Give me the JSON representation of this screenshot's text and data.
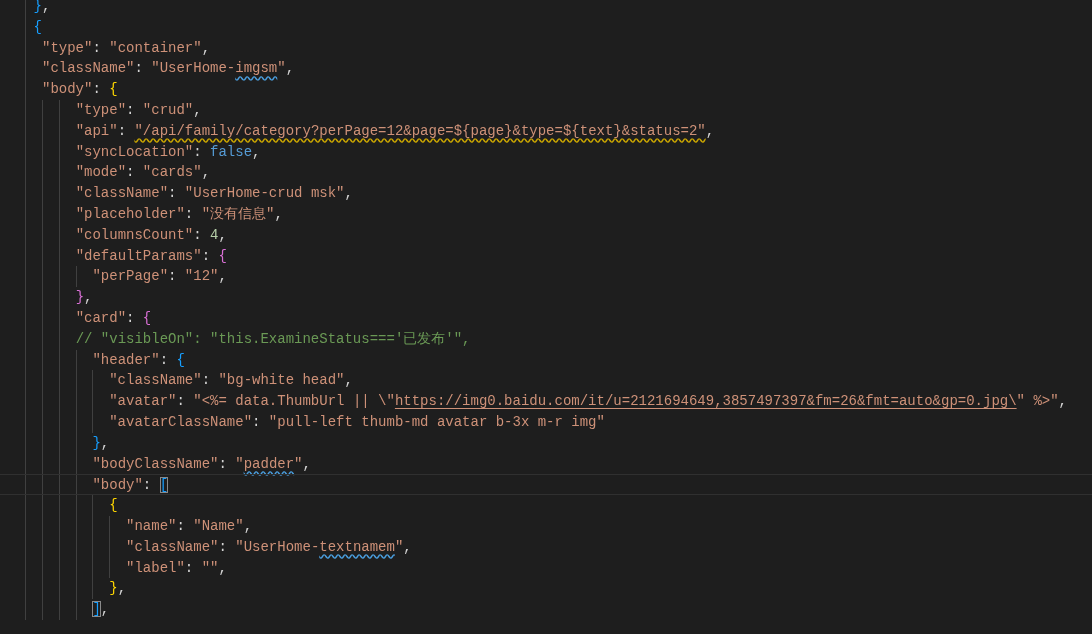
{
  "editor": {
    "lines": [
      {
        "tokens": [
          {
            "kind": "bracket",
            "text": "    }",
            "color": "#179fff"
          },
          {
            "kind": "punct",
            "text": ","
          }
        ]
      },
      {
        "tokens": [
          {
            "kind": "bracket",
            "text": "    {",
            "color": "#179fff"
          }
        ]
      },
      {
        "tokens": [
          {
            "kind": "key",
            "text": "     \"type\""
          },
          {
            "kind": "punct",
            "text": ": "
          },
          {
            "kind": "string",
            "text": "\"container\""
          },
          {
            "kind": "punct",
            "text": ","
          }
        ]
      },
      {
        "tokens": [
          {
            "kind": "key",
            "text": "     \"className\""
          },
          {
            "kind": "punct",
            "text": ": "
          },
          {
            "kind": "string",
            "text": "\"UserHome-"
          },
          {
            "kind": "string",
            "text": "imgsm",
            "spelling_error": true
          },
          {
            "kind": "string",
            "text": "\""
          },
          {
            "kind": "punct",
            "text": ","
          }
        ]
      },
      {
        "tokens": [
          {
            "kind": "key",
            "text": "     \"body\""
          },
          {
            "kind": "punct",
            "text": ": "
          },
          {
            "kind": "bracket",
            "text": "{",
            "color": "#ffd700"
          }
        ]
      },
      {
        "tokens": [
          {
            "kind": "key",
            "text": "         \"type\""
          },
          {
            "kind": "punct",
            "text": ": "
          },
          {
            "kind": "string",
            "text": "\"crud\""
          },
          {
            "kind": "punct",
            "text": ","
          }
        ]
      },
      {
        "tokens": [
          {
            "kind": "key",
            "text": "         \"api\""
          },
          {
            "kind": "punct",
            "text": ": "
          },
          {
            "kind": "string",
            "text": "\"/api/family/category?perPage=12&page=${page}&type=${text}&status=2\"",
            "warning": true
          },
          {
            "kind": "punct",
            "text": ","
          }
        ]
      },
      {
        "tokens": [
          {
            "kind": "key",
            "text": "         \"syncLocation\""
          },
          {
            "kind": "punct",
            "text": ": "
          },
          {
            "kind": "keyword",
            "text": "false"
          },
          {
            "kind": "punct",
            "text": ","
          }
        ]
      },
      {
        "tokens": [
          {
            "kind": "key",
            "text": "         \"mode\""
          },
          {
            "kind": "punct",
            "text": ": "
          },
          {
            "kind": "string",
            "text": "\"cards\""
          },
          {
            "kind": "punct",
            "text": ","
          }
        ]
      },
      {
        "tokens": [
          {
            "kind": "key",
            "text": "         \"className\""
          },
          {
            "kind": "punct",
            "text": ": "
          },
          {
            "kind": "string",
            "text": "\"UserHome-crud msk\""
          },
          {
            "kind": "punct",
            "text": ","
          }
        ]
      },
      {
        "tokens": [
          {
            "kind": "key",
            "text": "         \"placeholder\""
          },
          {
            "kind": "punct",
            "text": ": "
          },
          {
            "kind": "string",
            "text": "\"没有信息\""
          },
          {
            "kind": "punct",
            "text": ","
          }
        ]
      },
      {
        "tokens": [
          {
            "kind": "key",
            "text": "         \"columnsCount\""
          },
          {
            "kind": "punct",
            "text": ": "
          },
          {
            "kind": "number",
            "text": "4"
          },
          {
            "kind": "punct",
            "text": ","
          }
        ]
      },
      {
        "tokens": [
          {
            "kind": "key",
            "text": "         \"defaultParams\""
          },
          {
            "kind": "punct",
            "text": ": "
          },
          {
            "kind": "bracket",
            "text": "{",
            "color": "#da70d6"
          }
        ]
      },
      {
        "tokens": [
          {
            "kind": "key",
            "text": "           \"perPage\""
          },
          {
            "kind": "punct",
            "text": ": "
          },
          {
            "kind": "string",
            "text": "\"12\""
          },
          {
            "kind": "punct",
            "text": ","
          }
        ]
      },
      {
        "tokens": [
          {
            "kind": "bracket",
            "text": "         }",
            "color": "#da70d6"
          },
          {
            "kind": "punct",
            "text": ","
          }
        ]
      },
      {
        "tokens": [
          {
            "kind": "key",
            "text": "         \"card\""
          },
          {
            "kind": "punct",
            "text": ": "
          },
          {
            "kind": "bracket",
            "text": "{",
            "color": "#da70d6"
          }
        ]
      },
      {
        "tokens": [
          {
            "kind": "comment",
            "text": "         // \"visibleOn\": \"this.ExamineStatus==='已发布'\","
          }
        ]
      },
      {
        "tokens": [
          {
            "kind": "key",
            "text": "           \"header\""
          },
          {
            "kind": "punct",
            "text": ": "
          },
          {
            "kind": "bracket",
            "text": "{",
            "color": "#179fff"
          }
        ]
      },
      {
        "tokens": [
          {
            "kind": "key",
            "text": "             \"className\""
          },
          {
            "kind": "punct",
            "text": ": "
          },
          {
            "kind": "string",
            "text": "\"bg-white head\""
          },
          {
            "kind": "punct",
            "text": ","
          }
        ]
      },
      {
        "tokens": [
          {
            "kind": "key",
            "text": "             \"avatar\""
          },
          {
            "kind": "punct",
            "text": ": "
          },
          {
            "kind": "string",
            "text": "\"<%= data.ThumbUrl || \\\""
          },
          {
            "kind": "string",
            "text": "https://img0.baidu.com/it/u=2121694649,3857497397&fm=26&fmt=auto&gp=0.jpg\\",
            "link": true
          },
          {
            "kind": "string",
            "text": "\" %>\""
          },
          {
            "kind": "punct",
            "text": ","
          }
        ]
      },
      {
        "tokens": [
          {
            "kind": "key",
            "text": "             \"avatarClassName\""
          },
          {
            "kind": "punct",
            "text": ": "
          },
          {
            "kind": "string",
            "text": "\"pull-left thumb-md avatar b-3x m-r img\""
          }
        ]
      },
      {
        "tokens": [
          {
            "kind": "bracket",
            "text": "           }",
            "color": "#179fff"
          },
          {
            "kind": "punct",
            "text": ","
          }
        ]
      },
      {
        "tokens": [
          {
            "kind": "key",
            "text": "           \"bodyClassName\""
          },
          {
            "kind": "punct",
            "text": ": "
          },
          {
            "kind": "string",
            "text": "\""
          },
          {
            "kind": "string",
            "text": "padder",
            "spelling_error": true
          },
          {
            "kind": "string",
            "text": "\""
          },
          {
            "kind": "punct",
            "text": ","
          }
        ]
      },
      {
        "current": true,
        "tokens": [
          {
            "kind": "key",
            "text": "           \"body\""
          },
          {
            "kind": "punct",
            "text": ": "
          },
          {
            "kind": "bracket",
            "text": "[",
            "color": "#179fff",
            "matched": true
          }
        ]
      },
      {
        "tokens": [
          {
            "kind": "bracket",
            "text": "             {",
            "color": "#ffd700"
          }
        ]
      },
      {
        "tokens": [
          {
            "kind": "key",
            "text": "               \"name\""
          },
          {
            "kind": "punct",
            "text": ": "
          },
          {
            "kind": "string",
            "text": "\"Name\""
          },
          {
            "kind": "punct",
            "text": ","
          }
        ]
      },
      {
        "tokens": [
          {
            "kind": "key",
            "text": "               \"className\""
          },
          {
            "kind": "punct",
            "text": ": "
          },
          {
            "kind": "string",
            "text": "\"UserHome-"
          },
          {
            "kind": "string",
            "text": "textnamem",
            "spelling_error": true
          },
          {
            "kind": "string",
            "text": "\""
          },
          {
            "kind": "punct",
            "text": ","
          }
        ]
      },
      {
        "tokens": [
          {
            "kind": "key",
            "text": "               \"label\""
          },
          {
            "kind": "punct",
            "text": ": "
          },
          {
            "kind": "string",
            "text": "\"\""
          },
          {
            "kind": "punct",
            "text": ","
          }
        ]
      },
      {
        "tokens": [
          {
            "kind": "bracket",
            "text": "             }",
            "color": "#ffd700"
          },
          {
            "kind": "punct",
            "text": ","
          }
        ]
      },
      {
        "tokens": [
          {
            "kind": "bracket",
            "text": "           ]",
            "color": "#179fff",
            "matched": true
          },
          {
            "kind": "punct",
            "text": ","
          }
        ]
      }
    ]
  }
}
